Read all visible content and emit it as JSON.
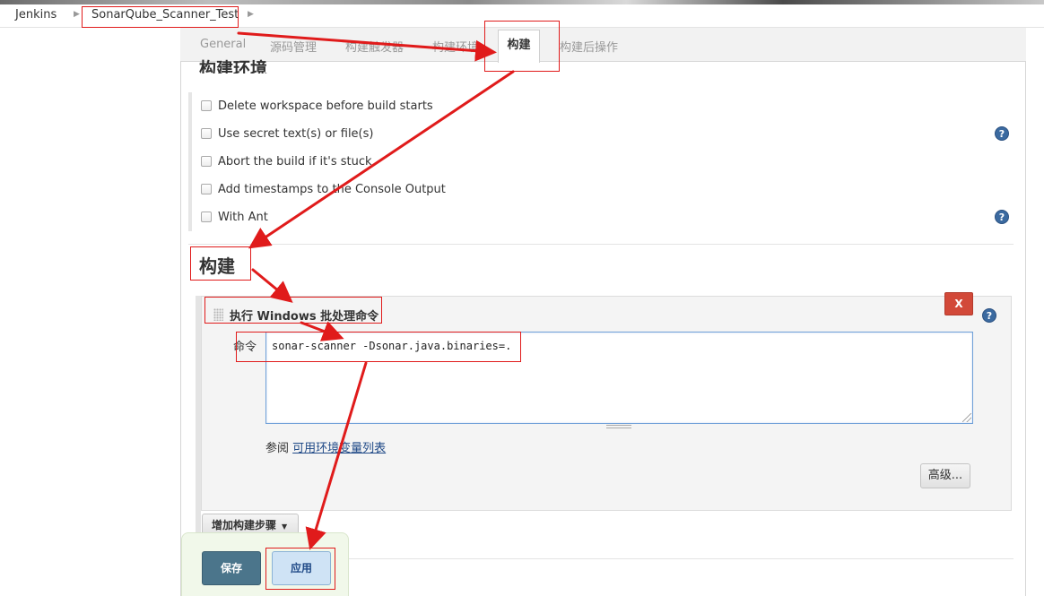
{
  "breadcrumb": {
    "items": [
      {
        "label": "Jenkins"
      },
      {
        "label": "SonarQube_Scanner_Test"
      }
    ]
  },
  "tabs": [
    {
      "label": "General"
    },
    {
      "label": "源码管理"
    },
    {
      "label": "构建触发器"
    },
    {
      "label": "构建环境"
    },
    {
      "label": "构建",
      "active": true
    },
    {
      "label": "构建后操作"
    }
  ],
  "build_env": {
    "title": "构建环境",
    "options": [
      {
        "label": "Delete workspace before build starts",
        "checked": false
      },
      {
        "label": "Use secret text(s) or file(s)",
        "checked": false
      },
      {
        "label": "Abort the build if it's stuck",
        "checked": false
      },
      {
        "label": "Add timestamps to the Console Output",
        "checked": false
      },
      {
        "label": "With Ant",
        "checked": false
      }
    ]
  },
  "build": {
    "title": "构建",
    "step": {
      "title": "执行 Windows 批处理命令",
      "delete_label": "X",
      "command_label": "命令",
      "command_value": "sonar-scanner -Dsonar.java.binaries=.",
      "see_also_prefix": "参阅 ",
      "see_also_link": "可用环境变量列表",
      "advanced_label": "高级..."
    },
    "add_step_label": "增加构建步骤"
  },
  "footer": {
    "save_label": "保存",
    "apply_label": "应用"
  },
  "help_icon": "?",
  "colors": {
    "annotation": "#e01b1b",
    "save_button": "#4b758b",
    "apply_button": "#cfe3f5",
    "delete_button": "#d24939",
    "link": "#204a87"
  }
}
